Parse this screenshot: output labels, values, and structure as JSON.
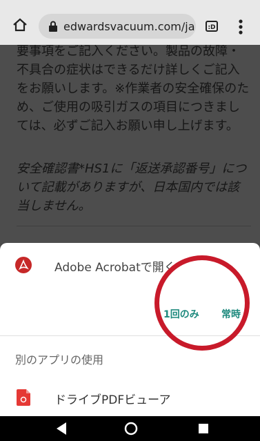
{
  "browser": {
    "url": "edwardsvacuum.com/ja",
    "tabs_label": ":D"
  },
  "content": {
    "paragraph1": "要事項をご記入ください。製品の故障・不具合の症状はできるだけ詳しくご記入をお願いします。※作業者の安全確保のため、ご使用の吸引ガスの項目につきましては、必ずご記入お願い申し上げます。",
    "paragraph2": "安全確認書*HS1に「返送承認番号」について記載がありますが、日本国内では該当しません。"
  },
  "sheet": {
    "open_with": "Adobe Acrobatで開く",
    "just_once": "1回のみ",
    "always": "常時",
    "other_apps": "別のアプリの使用",
    "drive_viewer": "ドライブPDFビューア"
  },
  "colors": {
    "accent": "#1e8a7e",
    "annotation_circle": "#c81a2a",
    "acrobat_red": "#c62828",
    "pdf_red": "#e53935"
  },
  "icons": {
    "home": "home-icon",
    "lock": "lock-icon",
    "tabs": "tabs-icon",
    "more": "more-vert-icon",
    "acrobat": "acrobat-icon",
    "pdf": "pdf-file-icon",
    "back": "back-icon",
    "nav_home": "nav-home-icon",
    "recent": "recent-apps-icon"
  }
}
